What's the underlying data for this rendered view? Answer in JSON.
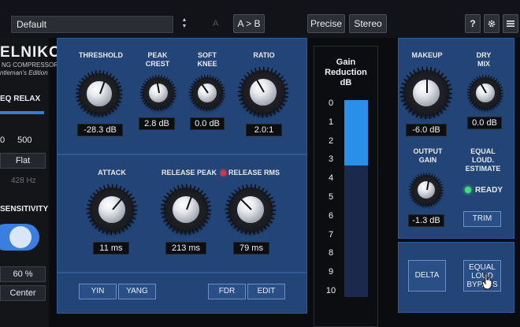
{
  "topbar": {
    "preset": "Default",
    "ab_a": "A",
    "ab_label": "A > B",
    "precise": "Precise",
    "stereo": "Stereo",
    "help": "?",
    "gear_icon": "gear-icon",
    "menu_icon": "menu-icon"
  },
  "left": {
    "brand": "ELNIKOV",
    "sub1": "NG COMPRESSOR",
    "sub2": "ntleman's Edition",
    "eq_relax": "EQ RELAX",
    "eq_num1": "0",
    "eq_num2": "500",
    "flat": "Flat",
    "hz": "428 Hz",
    "sensitivity": "SENSITIVITY",
    "sens_value": "60 %",
    "center": "Center"
  },
  "top_knobs": {
    "threshold": {
      "label": "THRESHOLD",
      "value": "-28.3 dB"
    },
    "peak_crest": {
      "label1": "PEAK",
      "label2": "CREST",
      "value": "2.8 dB"
    },
    "soft_knee": {
      "label1": "SOFT",
      "label2": "KNEE",
      "value": "0.0 dB"
    },
    "ratio": {
      "label": "RATIO",
      "value": "2.0:1"
    }
  },
  "mid_knobs": {
    "attack": {
      "label": "ATTACK",
      "value": "11 ms"
    },
    "release_peak": {
      "label": "RELEASE PEAK",
      "value": "213 ms"
    },
    "release_rms": {
      "label": "RELEASE RMS",
      "value": "79 ms"
    }
  },
  "bottom_buttons": {
    "yin": "YIN",
    "yang": "YANG",
    "fdr": "FDR",
    "edit": "EDIT"
  },
  "meter": {
    "title1": "Gain",
    "title2": "Reduction",
    "title3": "dB",
    "ticks": [
      "0",
      "1",
      "2",
      "3",
      "4",
      "5",
      "6",
      "7",
      "8",
      "9",
      "10"
    ],
    "reduction_db": 3.3
  },
  "right": {
    "makeup": {
      "label": "MAKEUP",
      "value": "-6.0 dB"
    },
    "dry_mix": {
      "label1": "DRY",
      "label2": "MIX",
      "value": "0.0 dB"
    },
    "output_gain": {
      "label1": "OUTPUT",
      "label2": "GAIN",
      "value": "-1.3 dB"
    },
    "equal_loud": {
      "label1": "EQUAL",
      "label2": "LOUD.",
      "label3": "ESTIMATE"
    },
    "ready": "READY",
    "trim": "TRIM",
    "delta": "DELTA",
    "eq_bypass1": "EQUAL",
    "eq_bypass2": "LOUD",
    "eq_bypass3": "BYPASS"
  }
}
